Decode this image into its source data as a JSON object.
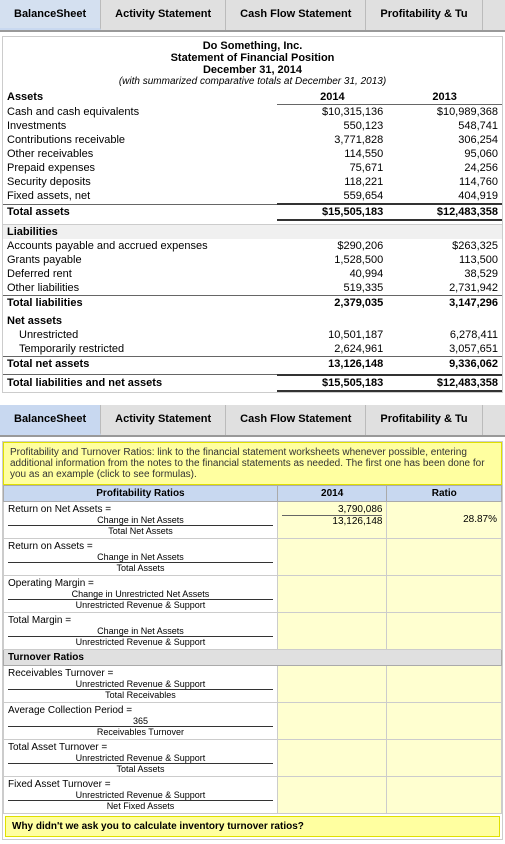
{
  "tabs": [
    {
      "label": "BalanceSheet",
      "active": false
    },
    {
      "label": "Activity Statement",
      "active": false
    },
    {
      "label": "Cash Flow Statement",
      "active": false
    },
    {
      "label": "Profitability & Tu",
      "active": true
    }
  ],
  "statement": {
    "company": "Do Something, Inc.",
    "title": "Statement of Financial Position",
    "date": "December 31, 2014",
    "note": "(with summarized comparative totals at December 31, 2013)",
    "col2014": "2014",
    "col2013": "2013",
    "assets_header": "Assets",
    "rows": [
      {
        "label": "Cash and cash equivalents",
        "v2014": "$10,315,136",
        "v2013": "$10,989,368"
      },
      {
        "label": "Investments",
        "v2014": "550,123",
        "v2013": "548,741"
      },
      {
        "label": "Contributions receivable",
        "v2014": "3,771,828",
        "v2013": "306,254"
      },
      {
        "label": "Other receivables",
        "v2014": "114,550",
        "v2013": "95,060"
      },
      {
        "label": "Prepaid expenses",
        "v2014": "75,671",
        "v2013": "24,256"
      },
      {
        "label": "Security deposits",
        "v2014": "118,221",
        "v2013": "114,760"
      },
      {
        "label": "Fixed assets, net",
        "v2014": "559,654",
        "v2013": "404,919"
      },
      {
        "label": "Total assets",
        "v2014": "$15,505,183",
        "v2013": "$12,483,358",
        "total": true
      }
    ],
    "liabilities_header": "Liabilities",
    "liability_rows": [
      {
        "label": "Accounts payable and accrued expenses",
        "v2014": "$290,206",
        "v2013": "$263,325"
      },
      {
        "label": "Grants payable",
        "v2014": "1,528,500",
        "v2013": "113,500"
      },
      {
        "label": "Deferred rent",
        "v2014": "40,994",
        "v2013": "38,529"
      },
      {
        "label": "Other liabilities",
        "v2014": "519,335",
        "v2013": "2,731,942"
      },
      {
        "label": "Total liabilities",
        "v2014": "2,379,035",
        "v2013": "3,147,296",
        "total": true
      }
    ],
    "netassets_header": "Net assets",
    "netasset_rows": [
      {
        "label": "Unrestricted",
        "v2014": "10,501,187",
        "v2013": "6,278,411"
      },
      {
        "label": "Temporarily restricted",
        "v2014": "2,624,961",
        "v2013": "3,057,651"
      },
      {
        "label": "Total net assets",
        "v2014": "13,126,148",
        "v2013": "9,336,062",
        "total": true
      }
    ],
    "grandtotal_label": "Total liabilities and net assets",
    "grandtotal_2014": "$15,505,183",
    "grandtotal_2013": "$12,483,358"
  },
  "profitability": {
    "note": "Profitability and Turnover Ratios: link to the financial statement worksheets whenever possible, entering additional information from the notes to the financial statements as needed. The first one has been done for you as an example (click to see formulas).",
    "table_header": "Profitability Ratios",
    "col_2014": "2014",
    "col_ratio": "Ratio",
    "ratios": [
      {
        "formula_label": "Return on Net Assets =",
        "formula_text": "Change in Net Assets",
        "formula_denom": "Total Net Assets",
        "val_num": "3,790,086",
        "val_denom": "13,126,148",
        "ratio": "28.87%"
      },
      {
        "formula_label": "Return on Assets =",
        "formula_text": "Change in Net Assets",
        "formula_denom": "Total Assets",
        "val_num": "",
        "val_denom": "",
        "ratio": ""
      },
      {
        "formula_label": "Operating Margin =",
        "formula_text": "Change in Unrestricted Net Assets",
        "formula_denom": "Unrestricted Revenue & Support",
        "val_num": "",
        "val_denom": "",
        "ratio": ""
      },
      {
        "formula_label": "Total Margin =",
        "formula_text": "Change in Net Assets",
        "formula_denom": "Unrestricted Revenue & Support",
        "val_num": "",
        "val_denom": "",
        "ratio": ""
      }
    ],
    "turnover_header": "Turnover Ratios",
    "turnover_ratios": [
      {
        "formula_label": "Receivables Turnover =",
        "formula_text": "Unrestricted Revenue & Support",
        "formula_denom": "Total Receivables",
        "val_num": "",
        "val_denom": "",
        "ratio": ""
      },
      {
        "formula_label": "Average Collection Period =",
        "formula_text": "365",
        "formula_denom": "Receivables Turnover",
        "val_num": "",
        "val_denom": "",
        "ratio": ""
      },
      {
        "formula_label": "Total Asset Turnover =",
        "formula_text": "Unrestricted Revenue & Support",
        "formula_denom": "Total Assets",
        "val_num": "",
        "val_denom": "",
        "ratio": ""
      },
      {
        "formula_label": "Fixed Asset Turnover =",
        "formula_text": "Unrestricted Revenue & Support",
        "formula_denom": "Net Fixed Assets",
        "val_num": "",
        "val_denom": "",
        "ratio": ""
      }
    ],
    "why_note": "Why didn't we ask you to calculate inventory turnover ratios?"
  }
}
